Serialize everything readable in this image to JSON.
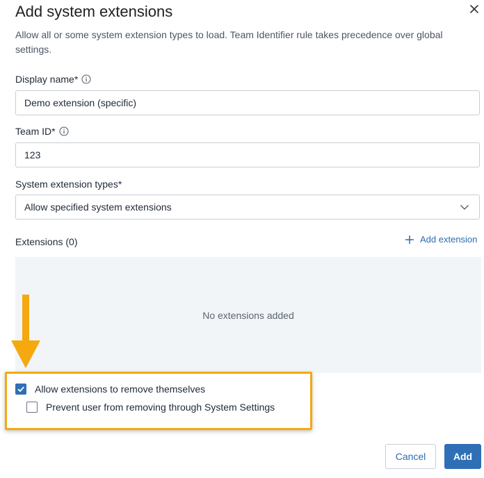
{
  "dialog": {
    "title": "Add system extensions",
    "description": "Allow all or some system extension types to load. Team Identifier rule takes precedence over global settings."
  },
  "form": {
    "display_name": {
      "label": "Display name*",
      "value": "Demo extension (specific)"
    },
    "team_id": {
      "label": "Team ID*",
      "value": "123"
    },
    "extension_types": {
      "label": "System extension types*",
      "selected": "Allow specified system extensions"
    }
  },
  "extensions": {
    "title": "Extensions (0)",
    "add_label": "Add extension",
    "empty_text": "No extensions added"
  },
  "options": {
    "allow_remove": {
      "label": "Allow extensions to remove themselves",
      "checked": true
    },
    "prevent_user_remove": {
      "label": "Prevent user from removing through System Settings",
      "checked": false
    }
  },
  "buttons": {
    "cancel": "Cancel",
    "add": "Add"
  },
  "colors": {
    "accent": "#2f6fb5",
    "highlight": "#f5a90f",
    "empty_bg": "#f2f5f8",
    "link": "#2b6cb0"
  }
}
